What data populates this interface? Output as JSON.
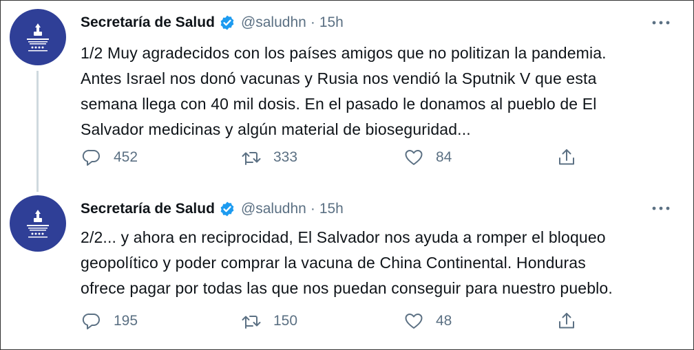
{
  "tweets": [
    {
      "name": "Secretaría de Salud",
      "handle": "@saludhn",
      "separator": "·",
      "time": "15h",
      "lines": [
        "1/2 Muy agradecidos con los países amigos que no politizan la pandemia.",
        "Antes Israel nos donó vacunas y Rusia nos vendió la Sputnik V que esta",
        "semana llega con 40 mil dosis. En el pasado le donamos al pueblo de El",
        "Salvador medicinas y algún material de bioseguridad..."
      ],
      "replies": "452",
      "retweets": "333",
      "likes": "84"
    },
    {
      "name": "Secretaría de Salud",
      "handle": "@saludhn",
      "separator": "·",
      "time": "15h",
      "lines": [
        "2/2... y ahora en reciprocidad, El Salvador nos ayuda a romper el bloqueo",
        "geopolítico y poder comprar la vacuna de China Continental. Honduras",
        "ofrece pagar por todas las que nos puedan conseguir para nuestro pueblo."
      ],
      "replies": "195",
      "retweets": "150",
      "likes": "48"
    }
  ],
  "icons": {
    "verified": "verified-badge-icon",
    "more": "more-options-icon",
    "reply": "reply-icon",
    "retweet": "retweet-icon",
    "like": "like-icon",
    "share": "share-icon"
  },
  "colors": {
    "avatar_bg": "#2f3f97",
    "verified": "#1d9bf0",
    "muted": "#5b7083",
    "thread_line": "#cfd9de"
  }
}
